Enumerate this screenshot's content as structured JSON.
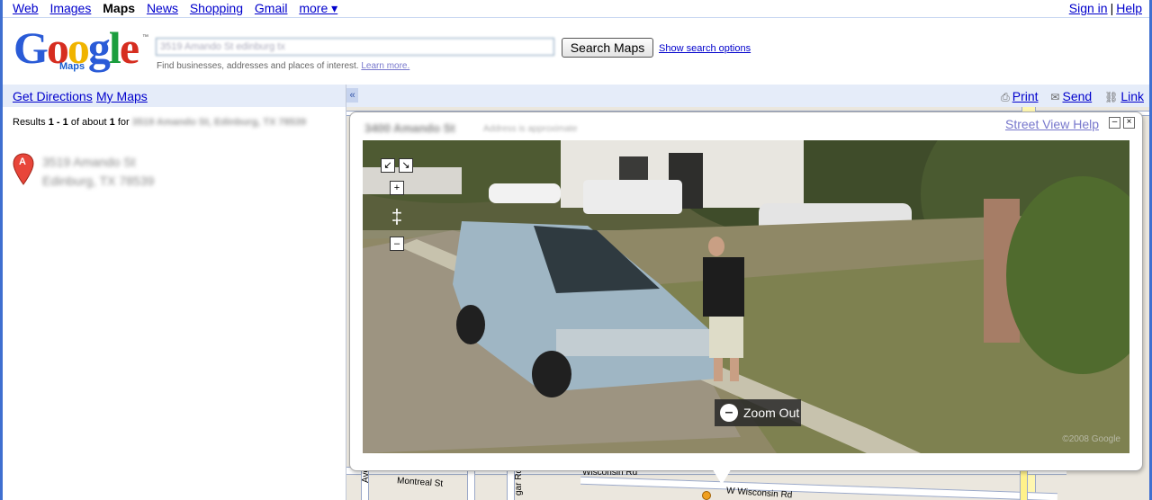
{
  "topnav": {
    "items": [
      "Web",
      "Images",
      "Maps",
      "News",
      "Shopping",
      "Gmail",
      "more ▾"
    ],
    "current": "Maps",
    "signin": "Sign in",
    "separator": "|",
    "help": "Help"
  },
  "header": {
    "logo_text": "Google",
    "logo_sub": "Maps",
    "logo_tm": "™",
    "search_value": "3519 Amando St edinburg tx",
    "search_button": "Search Maps",
    "search_options": "Show search options",
    "hint": "Find businesses, addresses and places of interest.",
    "learn_more": "Learn more."
  },
  "left_panel": {
    "get_directions": "Get Directions",
    "my_maps": "My Maps",
    "results_prefix": "Results",
    "results_range": "1 - 1",
    "results_of": "of about",
    "results_count": "1",
    "results_for": "for",
    "results_query": "3519 Amando St, Edinburg, TX 78539",
    "result_line1": "3519 Amando St",
    "result_line2": "Edinburg, TX 78539",
    "marker_letter": "A"
  },
  "map_bar": {
    "collapse": "«",
    "print": "Print",
    "send": "Send",
    "link": "Link"
  },
  "street_view": {
    "title": "3400 Amando St",
    "approx": "Address is approximate",
    "help": "Street View Help",
    "minimize": "–",
    "close": "×",
    "zoom_in": "+",
    "zoom_out": "–",
    "slider": "‡",
    "zoom_out_label": "Zoom Out",
    "zoom_out_symbol": "–",
    "copyright": "©2008 Google",
    "pan_left": "↙",
    "pan_right": "↘"
  },
  "map_streets": {
    "montreal": "Montreal St",
    "wisconsin": "Wisconsin Rd",
    "w_wisconsin": "W Wisconsin Rd",
    "ave": "Ave",
    "gar": "gar Rd"
  },
  "colors": {
    "frame": "#3f6fd0",
    "panel_bar": "#e5ecf9",
    "link": "#0000cc"
  }
}
